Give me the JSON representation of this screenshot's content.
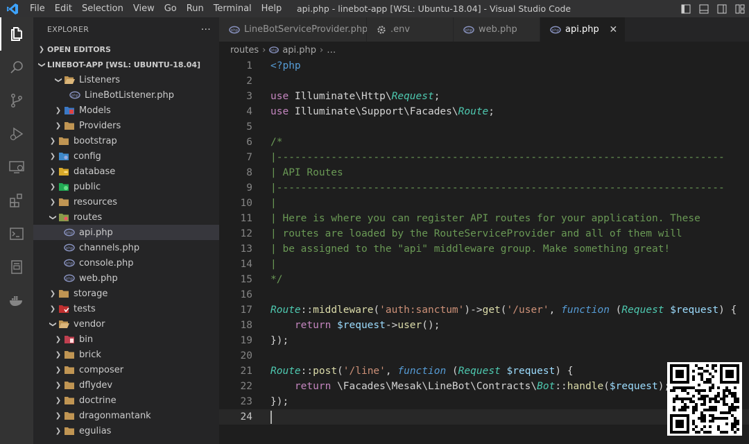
{
  "window": {
    "title": "api.php - linebot-app [WSL: Ubuntu-18.04] - Visual Studio Code",
    "menu": [
      "File",
      "Edit",
      "Selection",
      "View",
      "Go",
      "Run",
      "Terminal",
      "Help"
    ]
  },
  "activity_bar": [
    "explorer-icon",
    "search-icon",
    "source-control-icon",
    "run-debug-icon",
    "remote-explorer-icon",
    "extensions-icon",
    "terminal-icon",
    "notebook-icon",
    "docker-icon"
  ],
  "sidebar": {
    "title": "EXPLORER",
    "more": "···",
    "open_editors": "OPEN EDITORS",
    "project": "LINEBOT-APP [WSL: UBUNTU-18.04]",
    "tree": [
      {
        "label": "Listeners",
        "depth": 2,
        "type": "folder",
        "open": true,
        "icon": "folder-open-icon"
      },
      {
        "label": "LineBotListener.php",
        "depth": 3,
        "type": "file",
        "icon": "php-file-icon"
      },
      {
        "label": "Models",
        "depth": 2,
        "type": "folder",
        "open": false,
        "icon": "models-folder-icon"
      },
      {
        "label": "Providers",
        "depth": 2,
        "type": "folder",
        "open": false,
        "icon": "folder-icon"
      },
      {
        "label": "bootstrap",
        "depth": 1,
        "type": "folder",
        "open": false,
        "icon": "folder-icon"
      },
      {
        "label": "config",
        "depth": 1,
        "type": "folder",
        "open": false,
        "icon": "config-folder-icon"
      },
      {
        "label": "database",
        "depth": 1,
        "type": "folder",
        "open": false,
        "icon": "database-folder-icon"
      },
      {
        "label": "public",
        "depth": 1,
        "type": "folder",
        "open": false,
        "icon": "public-folder-icon"
      },
      {
        "label": "resources",
        "depth": 1,
        "type": "folder",
        "open": false,
        "icon": "folder-icon"
      },
      {
        "label": "routes",
        "depth": 1,
        "type": "folder",
        "open": true,
        "icon": "routes-folder-icon"
      },
      {
        "label": "api.php",
        "depth": 2,
        "type": "file",
        "icon": "php-file-icon",
        "selected": true
      },
      {
        "label": "channels.php",
        "depth": 2,
        "type": "file",
        "icon": "php-file-icon"
      },
      {
        "label": "console.php",
        "depth": 2,
        "type": "file",
        "icon": "php-file-icon"
      },
      {
        "label": "web.php",
        "depth": 2,
        "type": "file",
        "icon": "php-file-icon"
      },
      {
        "label": "storage",
        "depth": 1,
        "type": "folder",
        "open": false,
        "icon": "folder-icon"
      },
      {
        "label": "tests",
        "depth": 1,
        "type": "folder",
        "open": false,
        "icon": "tests-folder-icon"
      },
      {
        "label": "vendor",
        "depth": 1,
        "type": "folder",
        "open": true,
        "icon": "folder-open-icon"
      },
      {
        "label": "bin",
        "depth": 2,
        "type": "folder",
        "open": false,
        "icon": "bin-folder-icon"
      },
      {
        "label": "brick",
        "depth": 2,
        "type": "folder",
        "open": false,
        "icon": "folder-icon"
      },
      {
        "label": "composer",
        "depth": 2,
        "type": "folder",
        "open": false,
        "icon": "folder-icon"
      },
      {
        "label": "dflydev",
        "depth": 2,
        "type": "folder",
        "open": false,
        "icon": "folder-icon"
      },
      {
        "label": "doctrine",
        "depth": 2,
        "type": "folder",
        "open": false,
        "icon": "folder-icon"
      },
      {
        "label": "dragonmantank",
        "depth": 2,
        "type": "folder",
        "open": false,
        "icon": "folder-icon"
      },
      {
        "label": "egulias",
        "depth": 2,
        "type": "folder",
        "open": false,
        "icon": "folder-icon"
      }
    ]
  },
  "tabs": [
    {
      "label": "LineBotServiceProvider.php",
      "icon": "php-file-icon",
      "active": false
    },
    {
      "label": ".env",
      "icon": "gear-icon",
      "active": false
    },
    {
      "label": "web.php",
      "icon": "php-file-icon",
      "active": false
    },
    {
      "label": "api.php",
      "icon": "php-file-icon",
      "active": true,
      "close": "✕"
    }
  ],
  "breadcrumb": [
    "routes",
    "api.php",
    "…"
  ],
  "editor": {
    "current_line": 24,
    "lines": [
      [
        [
          "<?php",
          "tag"
        ]
      ],
      [],
      [
        [
          "use ",
          "kw"
        ],
        [
          "Illuminate\\Http\\",
          "txt"
        ],
        [
          "Request",
          "cls"
        ],
        [
          ";",
          "txt"
        ]
      ],
      [
        [
          "use ",
          "kw"
        ],
        [
          "Illuminate\\Support\\Facades\\",
          "txt"
        ],
        [
          "Route",
          "cls"
        ],
        [
          ";",
          "txt"
        ]
      ],
      [],
      [
        [
          "/*",
          "cmt"
        ]
      ],
      [
        [
          "|--------------------------------------------------------------------------",
          "cmt"
        ]
      ],
      [
        [
          "| API Routes",
          "cmt"
        ]
      ],
      [
        [
          "|--------------------------------------------------------------------------",
          "cmt"
        ]
      ],
      [
        [
          "|",
          "cmt"
        ]
      ],
      [
        [
          "| Here is where you can register API routes for your application. These",
          "cmt"
        ]
      ],
      [
        [
          "| routes are loaded by the RouteServiceProvider and all of them will",
          "cmt"
        ]
      ],
      [
        [
          "| be assigned to the \"api\" middleware group. Make something great!",
          "cmt"
        ]
      ],
      [
        [
          "|",
          "cmt"
        ]
      ],
      [
        [
          "*/",
          "cmt"
        ]
      ],
      [],
      [
        [
          "Route",
          "cls"
        ],
        [
          "::",
          "op"
        ],
        [
          "middleware",
          "fn"
        ],
        [
          "(",
          "txt"
        ],
        [
          "'auth:sanctum'",
          "str"
        ],
        [
          ")->",
          "txt"
        ],
        [
          "get",
          "fn"
        ],
        [
          "(",
          "txt"
        ],
        [
          "'/user'",
          "str"
        ],
        [
          ", ",
          "txt"
        ],
        [
          "function",
          "ky"
        ],
        [
          " (",
          "txt"
        ],
        [
          "Request",
          "cls"
        ],
        [
          " ",
          "txt"
        ],
        [
          "$request",
          "var"
        ],
        [
          ") {",
          "txt"
        ]
      ],
      [
        [
          "    return ",
          "kw"
        ],
        [
          "$request",
          "var"
        ],
        [
          "->",
          "txt"
        ],
        [
          "user",
          "fn"
        ],
        [
          "();",
          "txt"
        ]
      ],
      [
        [
          "});",
          "txt"
        ]
      ],
      [],
      [
        [
          "Route",
          "cls"
        ],
        [
          "::",
          "op"
        ],
        [
          "post",
          "fn"
        ],
        [
          "(",
          "txt"
        ],
        [
          "'/line'",
          "str"
        ],
        [
          ", ",
          "txt"
        ],
        [
          "function",
          "ky"
        ],
        [
          " (",
          "txt"
        ],
        [
          "Request",
          "cls"
        ],
        [
          " ",
          "txt"
        ],
        [
          "$request",
          "var"
        ],
        [
          ") {",
          "txt"
        ]
      ],
      [
        [
          "    return ",
          "kw"
        ],
        [
          "\\Facades\\Mesak\\LineBot\\Contracts\\",
          "txt"
        ],
        [
          "Bot",
          "cls"
        ],
        [
          "::",
          "op"
        ],
        [
          "handle",
          "fn"
        ],
        [
          "(",
          "txt"
        ],
        [
          "$request",
          "var"
        ],
        [
          ");",
          "txt"
        ]
      ],
      [
        [
          "});",
          "txt"
        ]
      ],
      []
    ]
  }
}
